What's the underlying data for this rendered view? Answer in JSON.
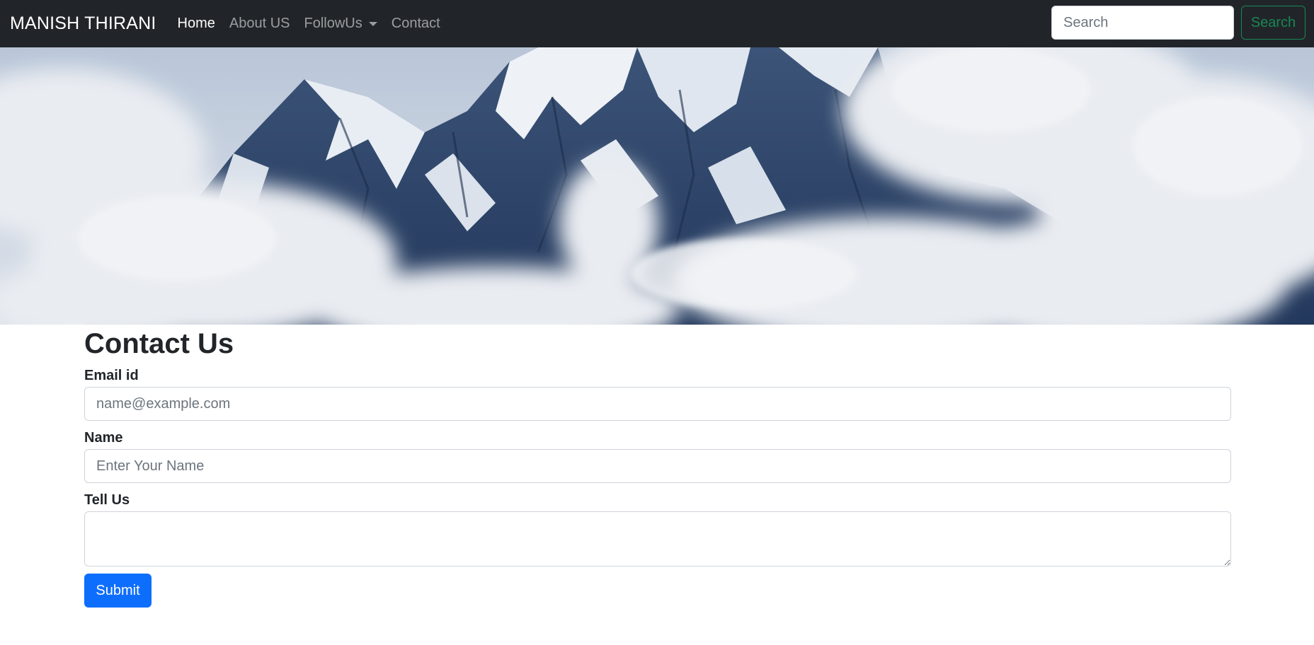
{
  "navbar": {
    "brand": "MANISH THIRANI",
    "links": [
      {
        "label": "Home"
      },
      {
        "label": "About US"
      },
      {
        "label": "FollowUs"
      },
      {
        "label": "Contact"
      }
    ],
    "search": {
      "placeholder": "Search",
      "button_label": "Search"
    }
  },
  "hero": {
    "image": "snow-capped mountain peak surrounded by clouds"
  },
  "contact": {
    "title": "Contact Us",
    "email": {
      "label": "Email id",
      "placeholder": "name@example.com"
    },
    "name": {
      "label": "Name",
      "placeholder": "Enter Your Name"
    },
    "message": {
      "label": "Tell Us",
      "placeholder": ""
    },
    "submit_label": "Submit"
  },
  "colors": {
    "navbar_bg": "#212529",
    "primary": "#0d6efd",
    "success": "#198754"
  }
}
